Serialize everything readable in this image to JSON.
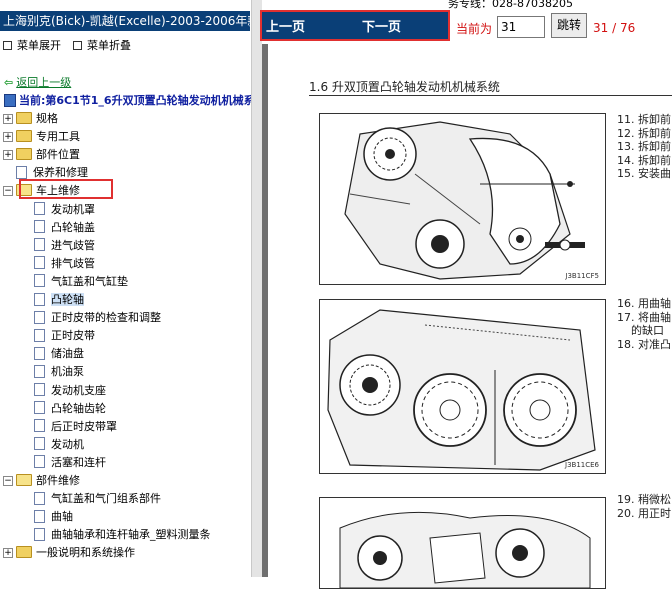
{
  "sidebar": {
    "title": "上海别克(Bick)-凯越(Excelle)-2003-2006年款",
    "expand_label": "菜单展开",
    "collapse_label": "菜单折叠",
    "back_label": "返回上一级",
    "current_label": "当前:第6C1节1_6升双顶置凸轮轴发动机机械系"
  },
  "tree": [
    {
      "label": "规格",
      "type": "folder",
      "level": 0,
      "expanded": false,
      "selected": false
    },
    {
      "label": "专用工具",
      "type": "folder",
      "level": 0,
      "expanded": false,
      "selected": false
    },
    {
      "label": "部件位置",
      "type": "folder",
      "level": 0,
      "expanded": false,
      "selected": false
    },
    {
      "label": "保养和修理",
      "type": "doc",
      "level": 0,
      "expanded": false,
      "selected": false
    },
    {
      "label": "车上维修",
      "type": "folder",
      "level": 0,
      "expanded": true,
      "selected": false
    },
    {
      "label": "发动机罩",
      "type": "doc",
      "level": 1,
      "expanded": false,
      "selected": false
    },
    {
      "label": "凸轮轴盖",
      "type": "doc",
      "level": 1,
      "expanded": false,
      "selected": false
    },
    {
      "label": "进气歧管",
      "type": "doc",
      "level": 1,
      "expanded": false,
      "selected": false
    },
    {
      "label": "排气歧管",
      "type": "doc",
      "level": 1,
      "expanded": false,
      "selected": false
    },
    {
      "label": "气缸盖和气缸垫",
      "type": "doc",
      "level": 1,
      "expanded": false,
      "selected": false
    },
    {
      "label": "凸轮轴",
      "type": "doc",
      "level": 1,
      "expanded": false,
      "selected": true
    },
    {
      "label": "正时皮带的检查和调整",
      "type": "doc",
      "level": 1,
      "expanded": false,
      "selected": false
    },
    {
      "label": "正时皮带",
      "type": "doc",
      "level": 1,
      "expanded": false,
      "selected": false
    },
    {
      "label": "储油盘",
      "type": "doc",
      "level": 1,
      "expanded": false,
      "selected": false
    },
    {
      "label": "机油泵",
      "type": "doc",
      "level": 1,
      "expanded": false,
      "selected": false
    },
    {
      "label": "发动机支座",
      "type": "doc",
      "level": 1,
      "expanded": false,
      "selected": false
    },
    {
      "label": "凸轮轴齿轮",
      "type": "doc",
      "level": 1,
      "expanded": false,
      "selected": false
    },
    {
      "label": "后正时皮带罩",
      "type": "doc",
      "level": 1,
      "expanded": false,
      "selected": false
    },
    {
      "label": "发动机",
      "type": "doc",
      "level": 1,
      "expanded": false,
      "selected": false
    },
    {
      "label": "活塞和连杆",
      "type": "doc",
      "level": 1,
      "expanded": false,
      "selected": false
    },
    {
      "label": "部件维修",
      "type": "folder",
      "level": 0,
      "expanded": true,
      "selected": false
    },
    {
      "label": "气缸盖和气门组系部件",
      "type": "doc",
      "level": 1,
      "expanded": false,
      "selected": false
    },
    {
      "label": "曲轴",
      "type": "doc",
      "level": 1,
      "expanded": false,
      "selected": false
    },
    {
      "label": "曲轴轴承和连杆轴承_塑料测量条",
      "type": "doc",
      "level": 1,
      "expanded": false,
      "selected": false
    },
    {
      "label": "一般说明和系统操作",
      "type": "folder",
      "level": 0,
      "expanded": false,
      "selected": false
    }
  ],
  "nav": {
    "top_text": "务专线：028-87038205",
    "prev_label": "上一页",
    "next_label": "下一页",
    "current_page_label": "当前为",
    "page_value": "31",
    "jump_label": "跳转",
    "page_count": "31 / 76"
  },
  "document": {
    "section_title": "1.6 升双顶置凸轮轴发动机机械系统",
    "figures": [
      {
        "code": "J3B11CF5"
      },
      {
        "code": "J3B11CE6"
      }
    ],
    "steps_group1": [
      "11. 拆卸前",
      "12. 拆卸前",
      "13. 拆卸前",
      "14. 拆卸前",
      "15. 安装曲"
    ],
    "steps_group2": [
      "16. 用曲轴",
      "17. 将曲轴",
      "    的缺口",
      "18. 对准凸"
    ],
    "steps_group3": [
      "19. 稍微松",
      "20. 用正时"
    ]
  },
  "colors": {
    "title_bar": "#0a3f77",
    "highlight_box": "#e03030",
    "page_text_red": "#d21010",
    "viewer_gray": "#6f6f6f"
  }
}
